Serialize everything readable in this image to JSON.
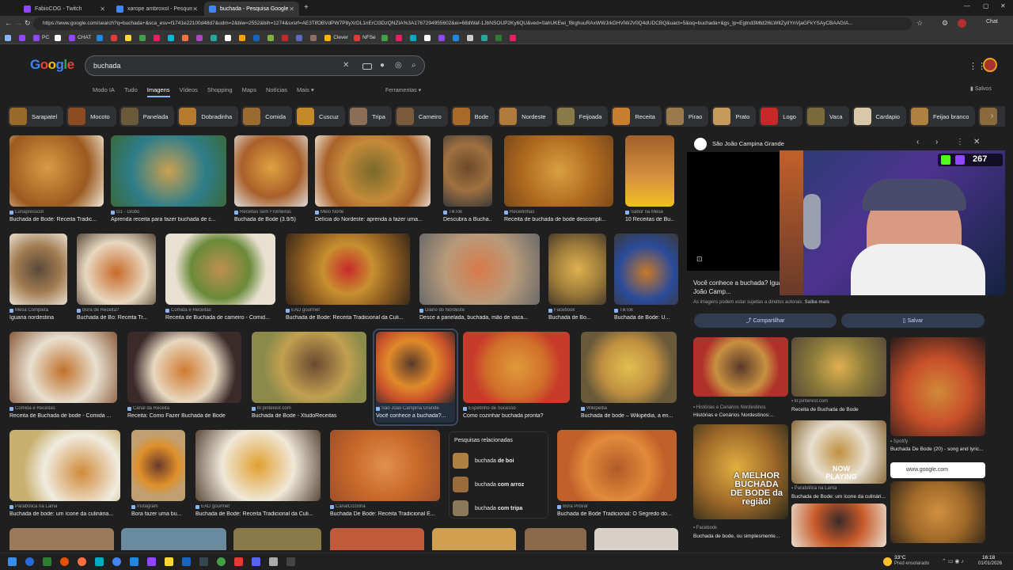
{
  "browser": {
    "tabs": [
      {
        "title": "FabioCOG - Twitch",
        "color": "#9146ff"
      },
      {
        "title": "xarope ambroxol - Pesquisa Google",
        "color": "#4285f4"
      },
      {
        "title": "buchada - Pesquisa Google",
        "color": "#4285f4"
      }
    ],
    "url": "https://www.google.com/search?q=buchada+&sca_esv=f1741e22100d48d7&udm=2&biw=2552&bih=1274&sxsrf=AE3TifOBVdPW7P8yXrDL1nErCl3DzQNZIA%3A1767294955602&ei=68dWaf-1JbNSOUP2Ky6QU&ved=0ahUKEwi_f8rghuuRAxWWJrkGHViWJV0Q4dUDCBQ&uact=5&oq=buchada+&gs_lp=Egtnd3Mtd2l6LWltZyIIYnVjaGFkYSAyCBAAGIA...",
    "bookmarks": [
      "PC",
      "CHAT",
      "Clever",
      "NFSe"
    ]
  },
  "search": {
    "query": "buchada"
  },
  "nav": [
    "Modo IA",
    "Tudo",
    "Imagens",
    "Vídeos",
    "Shopping",
    "Maps",
    "Notícias",
    "Mais"
  ],
  "tools_label": "Ferramentas",
  "saved_label": "Salvos",
  "chips": [
    "Sarapatel",
    "Mocoto",
    "Panelada",
    "Dobradinha",
    "Comida",
    "Cuscuz",
    "Tripa",
    "Carneiro",
    "Bode",
    "Nordeste",
    "Feijoada",
    "Receita",
    "Pirao",
    "Prato",
    "Logo",
    "Vaca",
    "Cardapio",
    "Feijao branco"
  ],
  "results": [
    {
      "src": "Lunapresscot",
      "title": "Buchada de Bode: Receita Tradic..."
    },
    {
      "src": "G1 - Globo",
      "title": "Aprenda receita para fazer buchada de c..."
    },
    {
      "src": "Receitas sem Fronteiras",
      "title": "Buchada de Bode (3.9/5)"
    },
    {
      "src": "Meio Norte",
      "title": "Delícia do Nordeste: aprenda a fazer uma..."
    },
    {
      "src": "TikTok",
      "title": "Descubra a Bucha..."
    },
    {
      "src": "Receitinhas",
      "title": "Receita de buchada de bode descompli..."
    },
    {
      "src": "Sabor na Mesa",
      "title": "10 Receitas de Bu..."
    },
    {
      "src": "Mesa Completa",
      "title": "Iguaria nordestina"
    },
    {
      "src": "Bora de Receita?",
      "title": "Buchada de Bo: Receita Tr..."
    },
    {
      "src": "Comida e Receitas",
      "title": "Receita de Buchada de cameiro - Comid..."
    },
    {
      "src": "EAD gourmet",
      "title": "Buchada de Bode: Receita Tradicional da Culi..."
    },
    {
      "src": "Diário do Nordeste",
      "title": "Desce a panelada, buchada, mão de vaca..."
    },
    {
      "src": "Facebook",
      "title": "Buchada de Bo..."
    },
    {
      "src": "TikTok",
      "title": "Buchada de Bode: U..."
    },
    {
      "src": "Comida e Receitas",
      "title": "Receita de Buchada de bode - Comida ..."
    },
    {
      "src": "Canal da Receita",
      "title": "Receita: Como Fazer Buchada de Bode"
    },
    {
      "src": "br.pinterest.com",
      "title": "Buchada de Bode - XtudoReceitas"
    },
    {
      "src": "São João Campina Grande",
      "title": "Você conhece a buchada?..."
    },
    {
      "src": "Espetinho de Sucesso",
      "title": "Como cozinhar buchada pronta?"
    },
    {
      "src": "Wikipedia",
      "title": "Buchada de bode – Wikipédia, a en..."
    },
    {
      "src": "Parabólica na Lama",
      "title": "Buchada de bode: um ícone da culinária..."
    },
    {
      "src": "Instagram",
      "title": "Bora fazer uma bu..."
    },
    {
      "src": "EAD gourmet",
      "title": "Buchada de Bode: Receita Tradicional da Culi..."
    },
    {
      "src": "CanalCozinha",
      "title": "Buchada De Bode: Receita Tradicional E..."
    },
    {
      "src": "Bora Provar",
      "title": "Buchada de Bode Tradicional: O Segredo do..."
    }
  ],
  "related": {
    "heading": "Pesquisas relacionadas",
    "items": [
      {
        "base": "buchada",
        "bold": "de boi"
      },
      {
        "base": "buchada",
        "bold": "com arroz"
      },
      {
        "base": "buchada",
        "bold": "com tripa"
      }
    ]
  },
  "panel": {
    "source": "São João Campina Grande",
    "title": "Você conhece a buchada? Iguaria... João Nordestino - São João Camp...",
    "copyright": "As imagens podem estar sujeitas a direitos autorais.",
    "learn_more": "Saiba mais",
    "share": "Compartilhar",
    "save": "Salvar",
    "viewers": "267",
    "now_playing": "NOW PLAYING",
    "thumbs": [
      {
        "src": "Histórias e Cenários Nordestinos",
        "title": "Histórias e Cenários Nordestinos:..."
      },
      {
        "src": "kr.pinterest.com",
        "title": "Receita de Buchada de Bode"
      },
      {
        "src": "Spotify",
        "title": "Buchada De Bode (20) - song and lyric..."
      },
      {
        "src": "Parabólica na Lama",
        "title": "Buchada de Bode: um ícone da culinári..."
      },
      {
        "src": "Facebook",
        "title": "Buchada de bode, ou simplesmente..."
      }
    ],
    "promo_text": "A MELHOR BUCHADA DE BODE da região!",
    "google_label": "www.google.com"
  },
  "taskbar": {
    "weather": "33°C",
    "weather_sub": "Pred ensolarado",
    "time": "16:18",
    "date": "01/01/2026"
  }
}
